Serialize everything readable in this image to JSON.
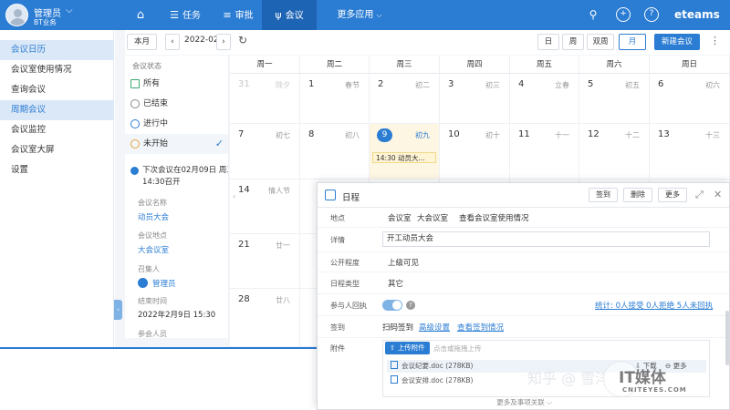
{
  "header": {
    "user_name": "管理员",
    "org": "BT业务",
    "nav": [
      {
        "label": "任务",
        "icon": "list-icon"
      },
      {
        "label": "审批",
        "icon": "menu-icon"
      },
      {
        "label": "会议",
        "icon": "meeting-icon"
      },
      {
        "label": "更多应用",
        "icon": "chevron-down-icon"
      }
    ],
    "logo": "eteams",
    "accent_color": "#2b7cd3"
  },
  "sidebar": {
    "items": [
      {
        "label": "会议日历"
      },
      {
        "label": "会议室使用情况"
      },
      {
        "label": "查询会议"
      },
      {
        "label": "周期会议"
      },
      {
        "label": "会议监控"
      },
      {
        "label": "会议室大屏"
      },
      {
        "label": "设置"
      }
    ]
  },
  "toolbar": {
    "this_month": "本月",
    "month": "2022-02",
    "views": [
      "日",
      "周",
      "双周",
      "月"
    ],
    "active_view": "月",
    "new_meeting": "新建会议",
    "more": "⋮"
  },
  "status_panel": {
    "title": "会议状态",
    "filters": [
      {
        "label": "所有"
      },
      {
        "label": "已结束"
      },
      {
        "label": "进行中"
      },
      {
        "label": "未开始"
      }
    ],
    "next_meeting": {
      "line1": "下次会议在02月09日 周三",
      "line2": "14:30召开",
      "name_label": "会议名称",
      "name_value": "动员大会",
      "place_label": "会议地点",
      "place_value": "大会议室",
      "host_label": "召集人",
      "host_value": "管理员",
      "end_label": "结束时间",
      "end_value": "2022年2月9日 15:30",
      "attendees_label": "参会人员"
    }
  },
  "calendar": {
    "weekdays": [
      "周一",
      "周二",
      "周三",
      "周四",
      "周五",
      "周六",
      "周日"
    ],
    "weeks": [
      [
        {
          "day": "31",
          "lunar": "除夕",
          "dim": true
        },
        {
          "day": "1",
          "lunar": "春节"
        },
        {
          "day": "2",
          "lunar": "初二"
        },
        {
          "day": "3",
          "lunar": "初三"
        },
        {
          "day": "4",
          "lunar": "立春"
        },
        {
          "day": "5",
          "lunar": "初五"
        },
        {
          "day": "6",
          "lunar": "初六"
        }
      ],
      [
        {
          "day": "7",
          "lunar": "初七"
        },
        {
          "day": "8",
          "lunar": "初八"
        },
        {
          "day": "9",
          "lunar": "初九",
          "today": true,
          "event": "14:30 动员大..."
        },
        {
          "day": "10",
          "lunar": "初十"
        },
        {
          "day": "11",
          "lunar": "十一"
        },
        {
          "day": "12",
          "lunar": "十二"
        },
        {
          "day": "13",
          "lunar": "十三"
        }
      ],
      [
        {
          "day": "14",
          "lunar": "情人节"
        },
        {
          "day": "",
          "lunar": ""
        },
        {
          "day": "",
          "lunar": ""
        },
        {
          "day": "",
          "lunar": ""
        },
        {
          "day": "",
          "lunar": ""
        },
        {
          "day": "",
          "lunar": ""
        },
        {
          "day": "",
          "lunar": ""
        }
      ],
      [
        {
          "day": "21",
          "lunar": "廿一"
        },
        {
          "day": "",
          "lunar": ""
        },
        {
          "day": "",
          "lunar": ""
        },
        {
          "day": "",
          "lunar": ""
        },
        {
          "day": "",
          "lunar": ""
        },
        {
          "day": "",
          "lunar": ""
        },
        {
          "day": "",
          "lunar": ""
        }
      ],
      [
        {
          "day": "28",
          "lunar": "廿八"
        },
        {
          "day": "",
          "lunar": ""
        },
        {
          "day": "",
          "lunar": ""
        },
        {
          "day": "",
          "lunar": ""
        },
        {
          "day": "",
          "lunar": ""
        },
        {
          "day": "",
          "lunar": ""
        },
        {
          "day": "",
          "lunar": ""
        }
      ]
    ]
  },
  "dialog": {
    "title": "日程",
    "sign_btn": "签到",
    "delete_btn": "删除",
    "more_btn": "更多",
    "place_label": "地点",
    "place_value1": "会议室",
    "place_value2": "大会议室",
    "place_link": "查看会议室使用情况",
    "detail_label": "详情",
    "detail_value": "开工动员大会",
    "visibility_label": "公开程度",
    "visibility_value": "上级可见",
    "type_label": "日程类型",
    "type_value": "其它",
    "attend_label": "参与人回执",
    "help": "?",
    "stats": "统计: 0人接受 0人拒绝 5人未回执",
    "signin_label": "签到",
    "signin_value": "扫码签到",
    "adv_settings": "高级设置",
    "view_signin": "查看签到情况",
    "attach_label": "附件",
    "upload_btn": "上传附件",
    "upload_hint": "点击或拖拽上传",
    "files": [
      {
        "name": "会议纪要.doc",
        "size": "(278KB)"
      },
      {
        "name": "会议安排.doc",
        "size": "(278KB)"
      }
    ],
    "file_actions": [
      "下载",
      "更多"
    ],
    "more_related": "更多及事项关联"
  },
  "watermark": {
    "zh": "知乎 @ 雪洋",
    "it": "IT媒体",
    "en": "CNITEYES.COM"
  }
}
